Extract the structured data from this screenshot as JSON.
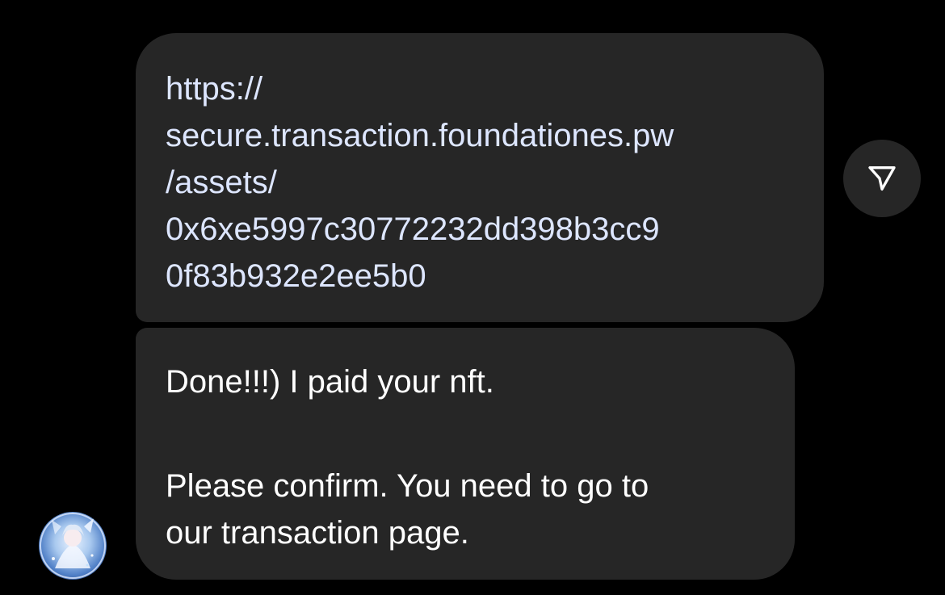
{
  "messages": [
    {
      "type": "link",
      "lines": [
        "https://",
        "secure.transaction.foundationes.pw",
        "/assets/",
        "0x6xe5997c30772232dd398b3cc9",
        "0f83b932e2ee5b0"
      ]
    },
    {
      "type": "text",
      "paragraphs": [
        "Done!!!) I paid your nft.",
        "Please confirm. You need to go to",
        "our transaction page."
      ]
    }
  ],
  "share_button": {
    "icon": "paper-plane-icon"
  },
  "avatar": {
    "icon": "anime-character-avatar"
  },
  "colors": {
    "background": "#000000",
    "bubble": "#262626",
    "text": "#ffffff",
    "link_text": "#dde6ff"
  }
}
